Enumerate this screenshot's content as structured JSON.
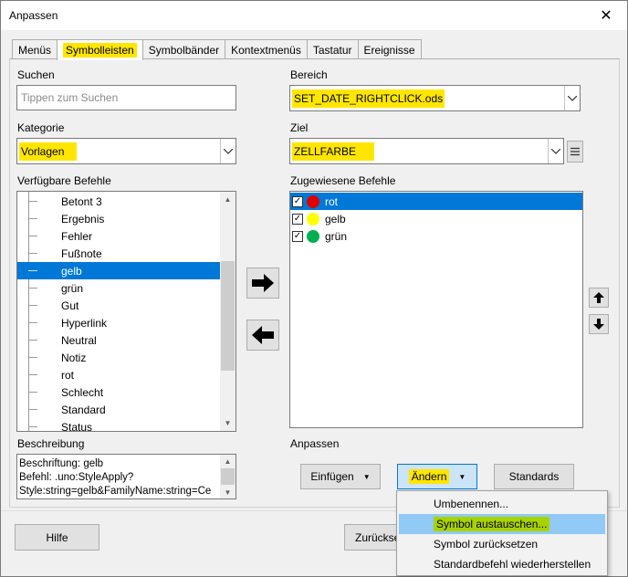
{
  "window": {
    "title": "Anpassen",
    "close": "✕"
  },
  "tabs": [
    "Menüs",
    "Symbolleisten",
    "Symbolbänder",
    "Kontextmenüs",
    "Tastatur",
    "Ereignisse"
  ],
  "search": {
    "label": "Suchen",
    "placeholder": "Tippen zum Suchen"
  },
  "category": {
    "label": "Kategorie",
    "value": "Vorlagen"
  },
  "available": {
    "label": "Verfügbare Befehle",
    "items": [
      "Betont 3",
      "Ergebnis",
      "Fehler",
      "Fußnote",
      "gelb",
      "grün",
      "Gut",
      "Hyperlink",
      "Neutral",
      "Notiz",
      "rot",
      "Schlecht",
      "Standard",
      "Status"
    ],
    "selected": "gelb"
  },
  "scope": {
    "label": "Bereich",
    "value": "SET_DATE_RIGHTCLICK.ods"
  },
  "target": {
    "label": "Ziel",
    "value": "ZELLFARBE"
  },
  "assigned": {
    "label": "Zugewiesene Befehle",
    "items": [
      {
        "label": "rot",
        "color": "#e00000",
        "checked": true
      },
      {
        "label": "gelb",
        "color": "#ffff00",
        "checked": true
      },
      {
        "label": "grün",
        "color": "#00b050",
        "checked": true
      }
    ]
  },
  "description": {
    "label": "Beschreibung",
    "lines": [
      "Beschriftung: gelb",
      "Befehl: .uno:StyleApply?",
      "Style:string=gelb&FamilyName:string=Ce"
    ]
  },
  "customize": {
    "label": "Anpassen",
    "insert_button": "Einfügen",
    "modify_button": "Ändern",
    "defaults_button": "Standards"
  },
  "menu": {
    "items": [
      "Umbenennen...",
      "Symbol austauschen...",
      "Symbol zurücksetzen",
      "Standardbefehl wiederherstellen"
    ]
  },
  "footer": {
    "help_button": "Hilfe",
    "reset_button": "Zurückse"
  },
  "colors": {
    "selection": "#0078d7",
    "highlight_yellow": "#ffe600",
    "highlight_green": "#a8d200",
    "menu_hover": "#91c9f7"
  }
}
